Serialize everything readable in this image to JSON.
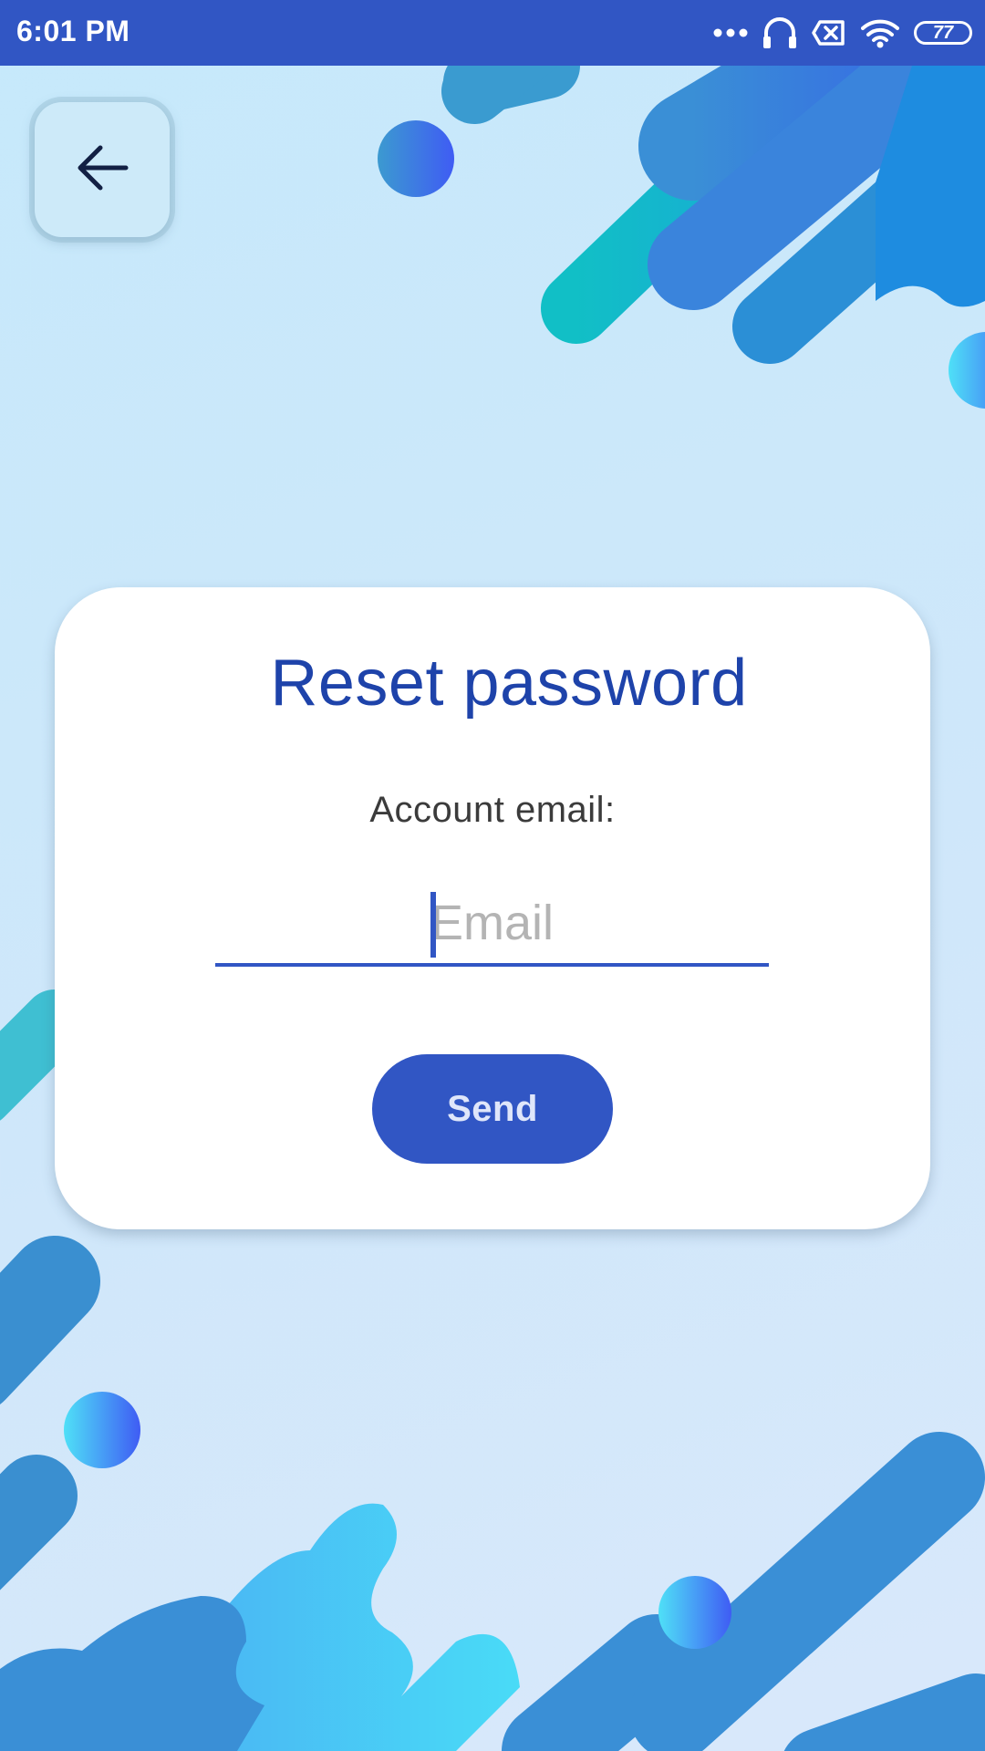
{
  "status_bar": {
    "time": "6:01 PM",
    "battery": "77",
    "icons": [
      "more-dots-icon",
      "headphones-icon",
      "no-sim-icon",
      "wifi-icon",
      "battery-icon"
    ]
  },
  "nav": {
    "back_icon": "arrow-left-icon"
  },
  "card": {
    "title": "Reset password",
    "email_label": "Account email:",
    "email_placeholder": "Email",
    "email_value": "",
    "send_label": "Send"
  },
  "colors": {
    "primary": "#3156c4",
    "title": "#1e43aa",
    "background": "#c6e9fb",
    "card": "#ffffff",
    "placeholder": "#b4b4b4"
  }
}
